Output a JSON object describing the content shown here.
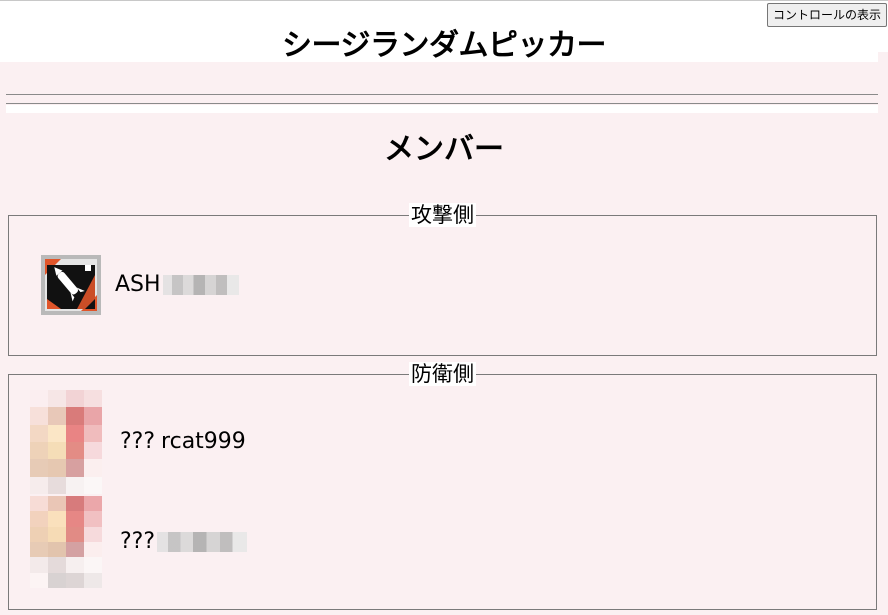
{
  "header": {
    "title": "シージランダムピッカー",
    "control_button_label": "コントロールの表示"
  },
  "members_section": {
    "title": "メンバー"
  },
  "attack": {
    "legend": "攻撃側",
    "members": [
      {
        "operator": "ASH",
        "player_name_hidden": true,
        "icon": "ash-operator-icon"
      }
    ]
  },
  "defense": {
    "legend": "防衛側",
    "members": [
      {
        "operator": "???",
        "player_name": "rcat999",
        "icon": "unknown-avatar"
      },
      {
        "operator": "???",
        "player_name_hidden": true,
        "icon": "unknown-avatar"
      }
    ]
  },
  "colors": {
    "background": "#fbf0f2",
    "accent_orange": "#e0552a"
  }
}
